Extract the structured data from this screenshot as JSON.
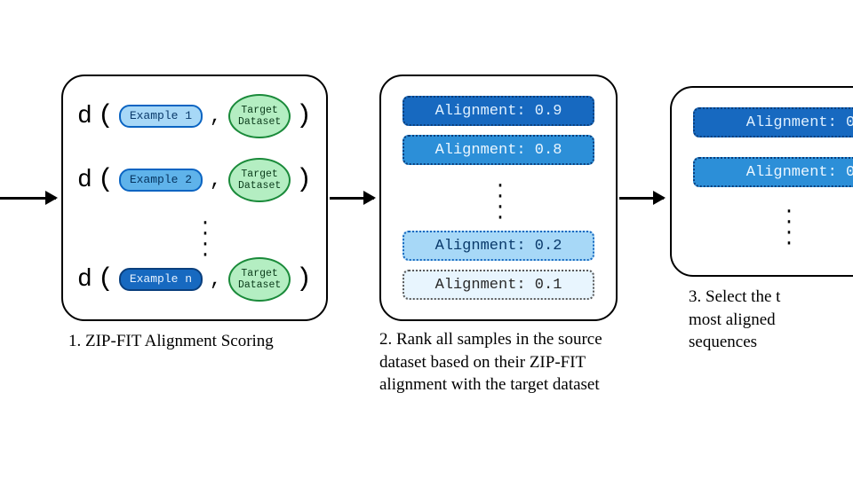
{
  "panel1": {
    "dlabel": "d",
    "rows": [
      {
        "example": "Example 1",
        "shade": "light"
      },
      {
        "example": "Example 2",
        "shade": "mid"
      },
      {
        "example": "Example n",
        "shade": "dark"
      }
    ],
    "target_label": "Target\nDataset",
    "caption": "1. ZIP-FIT Alignment Scoring"
  },
  "panel2": {
    "bars": [
      {
        "label": "Alignment: 0.9",
        "cls": "aln-09"
      },
      {
        "label": "Alignment: 0.8",
        "cls": "aln-08"
      },
      {
        "label": "Alignment: 0.2",
        "cls": "aln-02"
      },
      {
        "label": "Alignment: 0.1",
        "cls": "aln-01"
      }
    ],
    "caption": "2. Rank all samples in the source dataset based on their ZIP-FIT alignment with the target dataset"
  },
  "panel3": {
    "bars": [
      {
        "label": "Alignment: 0",
        "cls": "aln-09"
      },
      {
        "label": "Alignment: 0",
        "cls": "aln-08"
      }
    ],
    "caption": "3. Select the t\nmost aligned\nsequences"
  },
  "glyphs": {
    "lparen": "(",
    "rparen": ")",
    "comma": ",",
    "vdots": "⋮"
  }
}
